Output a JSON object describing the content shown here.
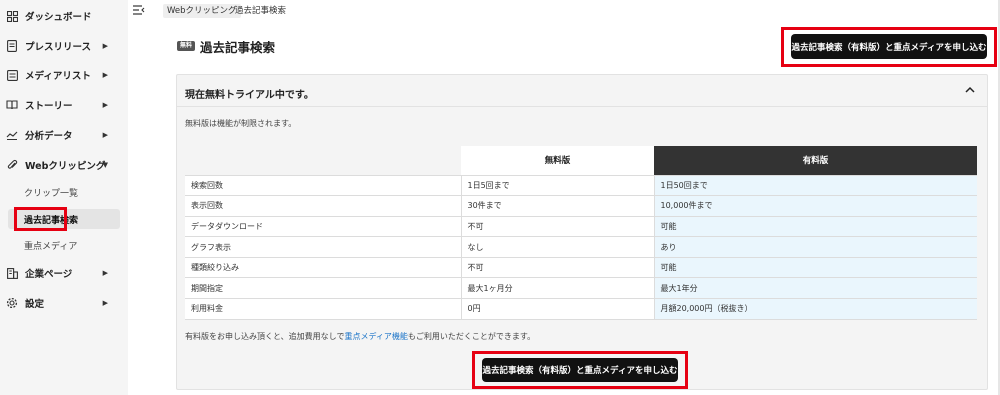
{
  "sidebar": {
    "items": [
      {
        "label": "ダッシュボード",
        "icon": "dashboard-icon"
      },
      {
        "label": "プレスリリース",
        "icon": "document-icon"
      },
      {
        "label": "メディアリスト",
        "icon": "list-icon"
      },
      {
        "label": "ストーリー",
        "icon": "book-icon"
      },
      {
        "label": "分析データ",
        "icon": "chart-line-icon"
      },
      {
        "label": "Webクリッピング",
        "icon": "paperclip-icon"
      },
      {
        "label": "企業ページ",
        "icon": "building-icon"
      },
      {
        "label": "設定",
        "icon": "gear-icon"
      }
    ],
    "sub_items": [
      {
        "label": "クリップ一覧"
      },
      {
        "label": "過去記事検索"
      },
      {
        "label": "重点メディア"
      }
    ]
  },
  "breadcrumb": {
    "parent": "Webクリッピング",
    "current": "過去記事検索"
  },
  "page": {
    "badge": "無料",
    "title": "過去記事検索",
    "cta_label": "過去記事検索（有料版）と重点メディアを申し込む"
  },
  "panel": {
    "title": "現在無料トライアル中です。",
    "notice": "無料版は機能が制限されます。",
    "table": {
      "headers": [
        "",
        "無料版",
        "有料版"
      ],
      "rows": [
        [
          "検索回数",
          "1日5回まで",
          "1日50回まで"
        ],
        [
          "表示回数",
          "30件まで",
          "10,000件まで"
        ],
        [
          "データダウンロード",
          "不可",
          "可能"
        ],
        [
          "グラフ表示",
          "なし",
          "あり"
        ],
        [
          "種類絞り込み",
          "不可",
          "可能"
        ],
        [
          "期間指定",
          "最大1ヶ月分",
          "最大1年分"
        ],
        [
          "利用料金",
          "0円",
          "月額20,000円（税抜き）"
        ]
      ]
    },
    "footnote_pre": "有料版をお申し込み頂くと、追加費用なしで",
    "footnote_link": "重点メディア機能",
    "footnote_post": "もご利用いただくことができます。",
    "cta_label": "過去記事検索（有料版）と重点メディアを申し込む"
  },
  "colors": {
    "highlight": "#e60012",
    "paid_header": "#333333",
    "paid_cell": "#eaf6fd",
    "link": "#1a73c8"
  }
}
